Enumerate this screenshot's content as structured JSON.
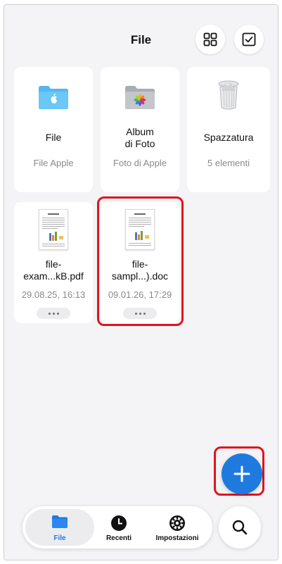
{
  "header": {
    "title": "File"
  },
  "items": [
    {
      "name": "File",
      "sub": "File Apple",
      "icon": "apple-folder-icon"
    },
    {
      "name": "Album\ndi Foto",
      "sub": "Foto di Apple",
      "icon": "photos-folder-icon"
    },
    {
      "name": "Spazzatura",
      "sub": "5 elementi",
      "icon": "trash-icon"
    },
    {
      "name": "file-\nexam...kB.pdf",
      "sub": "29.08.25, 16:13",
      "icon": "document-thumbnail"
    },
    {
      "name": "file-\nsampl...).doc",
      "sub": "09.01.26, 17:29",
      "icon": "document-thumbnail"
    }
  ],
  "tabs": [
    {
      "label": "File",
      "icon": "folder-icon",
      "selected": true
    },
    {
      "label": "Recenti",
      "icon": "clock-icon",
      "selected": false
    },
    {
      "label": "Impostazioni",
      "icon": "gear-icon",
      "selected": false
    }
  ],
  "colors": {
    "accent": "#1f7ae0",
    "highlight": "#e0141e",
    "background": "#f4f4f6"
  }
}
